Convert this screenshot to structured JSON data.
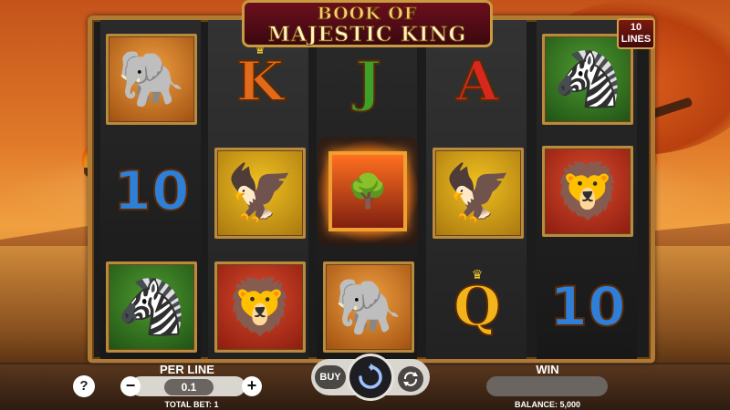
{
  "logo": {
    "line1": "BOOK OF",
    "line2": "MAJESTIC KING"
  },
  "lines_badge": {
    "count": "10",
    "label": "LINES"
  },
  "reels": [
    [
      {
        "type": "picture",
        "name": "elephant-symbol",
        "bg": "orange"
      },
      {
        "type": "card",
        "label": "10",
        "color": "#2e7fd8"
      },
      {
        "type": "picture",
        "name": "zebra-symbol",
        "bg": "green"
      }
    ],
    [
      {
        "type": "card",
        "label": "K",
        "color": "#e36a1a"
      },
      {
        "type": "picture",
        "name": "vulture-symbol",
        "bg": "gold"
      },
      {
        "type": "picture",
        "name": "lion-symbol",
        "bg": "red"
      }
    ],
    [
      {
        "type": "card",
        "label": "J",
        "color": "#3ca02a"
      },
      {
        "type": "scatter",
        "name": "book-symbol"
      },
      {
        "type": "picture",
        "name": "elephant-symbol",
        "bg": "orange"
      }
    ],
    [
      {
        "type": "card",
        "label": "A",
        "color": "#d8281e"
      },
      {
        "type": "picture",
        "name": "vulture-symbol",
        "bg": "gold"
      },
      {
        "type": "card",
        "label": "Q",
        "color": "#f2b41a"
      }
    ],
    [
      {
        "type": "picture",
        "name": "zebra-symbol",
        "bg": "green"
      },
      {
        "type": "picture",
        "name": "lion-symbol",
        "bg": "red"
      },
      {
        "type": "card",
        "label": "10",
        "color": "#2e7fd8"
      }
    ]
  ],
  "controls": {
    "help": "?",
    "per_line_label": "PER LINE",
    "minus": "−",
    "per_line_value": "0.1",
    "plus": "+",
    "total_bet": "TOTAL BET: 1",
    "buy": "BUY",
    "win_label": "WIN",
    "win_value": "",
    "balance": "BALANCE: 5,000"
  },
  "colors": {
    "frame": "#b07a34",
    "accent_red": "#6b0f1c",
    "gold": "#f5d070"
  }
}
